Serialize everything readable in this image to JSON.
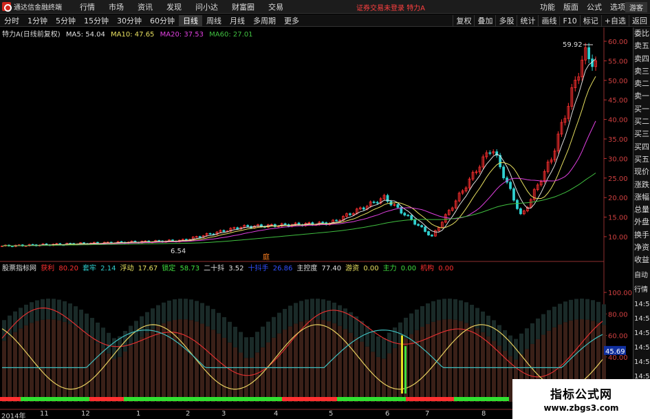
{
  "app": {
    "title": "通达信金融终端",
    "warning": "证券交易未登录",
    "stock": "特力A",
    "guest": "游客"
  },
  "menu": [
    "行情",
    "市场",
    "资讯",
    "发现",
    "问小达",
    "财富圈",
    "交易"
  ],
  "right_menu": [
    "功能",
    "版面",
    "公式",
    "选项"
  ],
  "periods": [
    "分时",
    "1分钟",
    "5分钟",
    "15分钟",
    "30分钟",
    "60分钟",
    "日线",
    "周线",
    "月线",
    "多周期",
    "更多"
  ],
  "active_period": "日线",
  "toolbar_right": [
    "复权",
    "叠加",
    "多股",
    "统计",
    "画线",
    "F10",
    "标记",
    "+自选",
    "返回"
  ],
  "main": {
    "title": "特力A(日线前复权)",
    "ma": [
      {
        "label": "MA5: 54.04",
        "color": "#e0e0e0"
      },
      {
        "label": "MA10: 47.65",
        "color": "#e8e060"
      },
      {
        "label": "MA20: 37.53",
        "color": "#e040e0"
      },
      {
        "label": "MA60: 27.01",
        "color": "#40c040"
      }
    ],
    "price_ticks": [
      "60.00",
      "55.00",
      "50.00",
      "45.00",
      "40.00",
      "35.00",
      "30.00",
      "25.00",
      "20.00",
      "15.00",
      "10.00"
    ],
    "high_label": "59.92",
    "low_label": "6.54",
    "marker": "庭"
  },
  "sub": {
    "name": "股票指标网",
    "items": [
      {
        "label": "获利",
        "value": "80.20",
        "color": "#ff3030"
      },
      {
        "label": "套牢",
        "value": "2.14",
        "color": "#30d0d0"
      },
      {
        "label": "浮动",
        "value": "17.67",
        "color": "#e8e060"
      },
      {
        "label": "锁定",
        "value": "58.73",
        "color": "#40e040"
      },
      {
        "label": "二十抖",
        "value": "3.52",
        "color": "#e0e0e0"
      },
      {
        "label": "十抖手",
        "value": "26.86",
        "color": "#3050ff"
      },
      {
        "label": "主控度",
        "value": "77.40",
        "color": "#e0e0e0"
      },
      {
        "label": "游资",
        "value": "0.00",
        "color": "#e8e060"
      },
      {
        "label": "主力",
        "value": "0.00",
        "color": "#40e040"
      },
      {
        "label": "机构",
        "value": "0.00",
        "color": "#ff3030"
      }
    ],
    "ticks": [
      "100.00",
      "80.00",
      "60.00",
      "40.00"
    ],
    "current_value": "45.69"
  },
  "side_panel": [
    "委比",
    "卖五",
    "卖四",
    "卖三",
    "卖二",
    "卖一",
    "买一",
    "买二",
    "买三",
    "买四",
    "买五",
    "现价",
    "涨跌",
    "涨幅",
    "总量",
    "外盘",
    "换手",
    "净资",
    "收益"
  ],
  "side_panel2": [
    "自动",
    "行情",
    "14:5",
    "14:5",
    "14:5",
    "14:5",
    "14:5",
    "14:5",
    "14:5",
    "14:5"
  ],
  "dates": [
    "2014年",
    "11",
    "12",
    "1",
    "2",
    "3",
    "4",
    "5",
    "6",
    "7",
    "8"
  ],
  "watermark": {
    "line1": "指标公式网",
    "line2": "www.zbgs3.com"
  },
  "colors": {
    "up": "#ff3030",
    "down": "#30d0d0",
    "bg": "#000000"
  }
}
